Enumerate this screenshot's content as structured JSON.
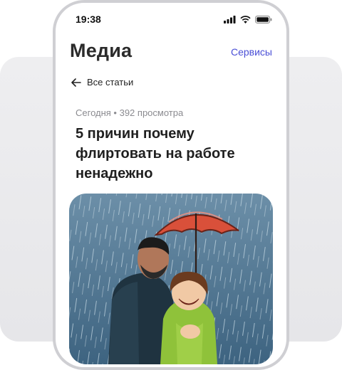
{
  "status_bar": {
    "time": "19:38",
    "icons": [
      "signal-icon",
      "wifi-icon",
      "battery-icon"
    ]
  },
  "header": {
    "title": "Медиа",
    "services_label": "Сервисы"
  },
  "nav": {
    "back_label": "Все статьи",
    "back_icon": "arrow-left-icon"
  },
  "article": {
    "meta": "Сегодня • 392 просмотра",
    "title": "5 причин почему флиртовать на работе ненадежно"
  },
  "colors": {
    "accent": "#4a4fd6",
    "umbrella": "#d9503a",
    "jacket_woman": "#8fc23a",
    "rain_bg": "#4f7491"
  }
}
